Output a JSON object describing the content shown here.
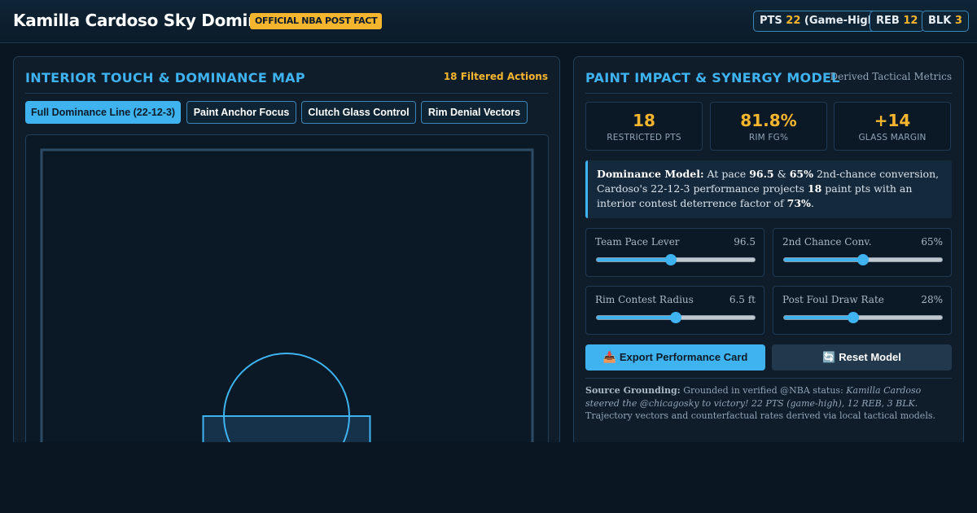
{
  "header": {
    "title": "Kamilla Cardoso Sky Dominance",
    "badge": "OFFICIAL NBA POST FACT",
    "stats": [
      {
        "label": "PTS",
        "value": "22",
        "suffix": " (Game-High)"
      },
      {
        "label": "REB",
        "value": "12",
        "suffix": ""
      },
      {
        "label": "BLK",
        "value": "3",
        "suffix": ""
      }
    ]
  },
  "left_panel": {
    "title": "INTERIOR TOUCH & DOMINANCE MAP",
    "meta": "18 Filtered Actions",
    "filters": [
      {
        "label": "Full Dominance Line (22-12-3)",
        "active": true
      },
      {
        "label": "Paint Anchor Focus",
        "active": false
      },
      {
        "label": "Clutch Glass Control",
        "active": false
      },
      {
        "label": "Rim Denial Vectors",
        "active": false
      }
    ]
  },
  "right_panel": {
    "title": "PAINT IMPACT & SYNERGY MODEL",
    "meta": "Derived Tactical Metrics",
    "metrics": [
      {
        "value": "18",
        "label": "RESTRICTED PTS"
      },
      {
        "value": "81.8%",
        "label": "RIM FG%"
      },
      {
        "value": "+14",
        "label": "GLASS MARGIN"
      }
    ],
    "model": {
      "lead": "Dominance Model:",
      "t1": " At pace ",
      "pace": "96.5",
      "t2": " & ",
      "conv": "65%",
      "t3": " 2nd-chance conversion, Cardoso's 22-12-3 performance projects ",
      "paint": "18",
      "t4": " paint pts with an interior contest deterrence factor of ",
      "factor": "73%",
      "t5": "."
    },
    "sliders": [
      {
        "label": "Team Pace Lever",
        "display": "96.5",
        "fraction": 0.47
      },
      {
        "label": "2nd Chance Conv.",
        "display": "65%",
        "fraction": 0.5
      },
      {
        "label": "Rim Contest Radius",
        "display": "6.5 ft",
        "fraction": 0.5
      },
      {
        "label": "Post Foul Draw Rate",
        "display": "28%",
        "fraction": 0.44
      }
    ],
    "export_label": "Export Performance Card",
    "export_icon": "📥",
    "reset_label": "Reset Model",
    "reset_icon": "🔄",
    "source": {
      "lead": "Source Grounding:",
      "t1": " Grounded in verified @NBA status: ",
      "quote": "Kamilla Cardoso steered the @chicagosky to victory! 22 PTS (game-high), 12 REB, 3 BLK.",
      "t2": " Trajectory vectors and counterfactual rates derived via local tactical models."
    }
  },
  "colors": {
    "accent": "#3fb3f0",
    "gold": "#f5b52e",
    "background": "#0a1622",
    "panel": "#0f1d2b"
  }
}
